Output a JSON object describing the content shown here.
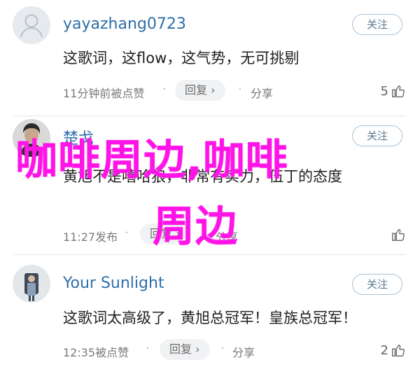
{
  "comments": [
    {
      "username": "yayazhang0723",
      "follow_label": "关注",
      "text": "这歌词，这flow，这气势，无可挑剔",
      "time": "11分钟前被点赞",
      "reply_label": "回复",
      "share_label": "分享",
      "likes": "5"
    },
    {
      "username": "楚戈",
      "follow_label": "关注",
      "text": "黄旭不是嘻哈狼，非常有实力，伍丁的态度",
      "time": "11:27发布",
      "reply_label": "回复",
      "share_label": "分享",
      "likes": ""
    },
    {
      "username": "Your Sunlight",
      "follow_label": "关注",
      "text": "这歌词太高级了，黄旭总冠军！皇族总冠军！",
      "time": "12:35被点赞",
      "reply_label": "回复",
      "share_label": "分享",
      "likes": "2"
    }
  ],
  "overlay": {
    "line1": "咖啡周边,咖啡",
    "line2": "周边"
  }
}
